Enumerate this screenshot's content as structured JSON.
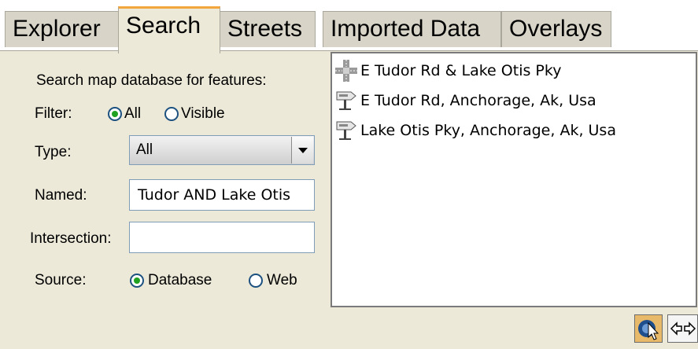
{
  "tabs": [
    {
      "label": "Explorer"
    },
    {
      "label": "Search"
    },
    {
      "label": "Streets"
    },
    {
      "label": "Imported Data"
    },
    {
      "label": "Overlays"
    }
  ],
  "active_tab": "Search",
  "form": {
    "heading": "Search map database for features:",
    "filter_label": "Filter:",
    "filter_all": "All",
    "filter_visible": "Visible",
    "filter_selected": "All",
    "type_label": "Type:",
    "type_value": "All",
    "named_label": "Named:",
    "named_value": "Tudor AND Lake Otis",
    "intersection_label": "Intersection:",
    "intersection_value": "",
    "source_label": "Source:",
    "source_database": "Database",
    "source_web": "Web",
    "source_selected": "Database"
  },
  "results": [
    {
      "icon": "intersection-icon",
      "text": "E Tudor Rd & Lake Otis Pky"
    },
    {
      "icon": "street-sign-icon",
      "text": "E Tudor Rd, Anchorage, Ak, Usa"
    },
    {
      "icon": "street-sign-icon",
      "text": "Lake Otis Pky, Anchorage, Ak, Usa"
    }
  ],
  "toolbar": {
    "select_icon": "pointer-select-icon",
    "go_icon": "arrow-go-icon"
  },
  "colors": {
    "panel": "#ece9d8",
    "tab_inactive": "#d8d4c8",
    "active_tab_accent": "#f3a63c",
    "field_border": "#7f9db9",
    "radio_dot": "#21a121"
  }
}
